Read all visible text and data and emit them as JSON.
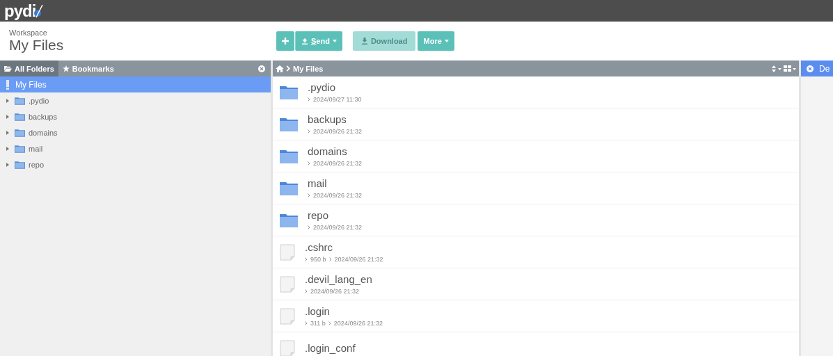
{
  "app": {
    "logo": "pydi"
  },
  "workspace": {
    "label": "Workspace",
    "title": "My Files"
  },
  "toolbar": [
    {
      "kind": "add",
      "disabled": false
    },
    {
      "kind": "send",
      "label": "Send",
      "disabled": false,
      "caret": true
    },
    {
      "kind": "download",
      "label": "Download",
      "disabled": true
    },
    {
      "kind": "more",
      "label": "More",
      "disabled": false,
      "caret": true
    }
  ],
  "left_panel": {
    "tabs": [
      {
        "label": "All Folders",
        "selected": true
      },
      {
        "label": "Bookmarks",
        "selected": false
      }
    ],
    "tree": {
      "label": "My Files",
      "selected": true,
      "children": [
        {
          "label": ".pydio",
          "expanded": false,
          "selected": false
        },
        {
          "label": "backups",
          "expanded": false,
          "selected": false
        },
        {
          "label": "domains",
          "expanded": false,
          "selected": false
        },
        {
          "label": "mail",
          "expanded": false,
          "selected": false
        },
        {
          "label": "repo",
          "expanded": false,
          "selected": false
        }
      ]
    }
  },
  "main_panel": {
    "breadcrumb": "My Files",
    "files": [
      {
        "kind": "folder",
        "name": ".pydio",
        "date": "2024/09/27 11:30"
      },
      {
        "kind": "folder",
        "name": "backups",
        "date": "2024/09/26 21:32"
      },
      {
        "kind": "folder",
        "name": "domains",
        "date": "2024/09/26 21:32"
      },
      {
        "kind": "folder",
        "name": "mail",
        "date": "2024/09/26 21:32"
      },
      {
        "kind": "folder",
        "name": "repo",
        "date": "2024/09/26 21:32"
      },
      {
        "kind": "file",
        "name": ".cshrc",
        "size": "950 b",
        "date": "2024/09/26 21:32"
      },
      {
        "kind": "file",
        "name": ".devil_lang_en",
        "date": "2024/09/26 21:32"
      },
      {
        "kind": "file",
        "name": ".login",
        "size": "311 b",
        "date": "2024/09/26 21:32"
      },
      {
        "kind": "file",
        "name": ".login_conf"
      }
    ]
  },
  "right_panel": {
    "title": "De"
  }
}
